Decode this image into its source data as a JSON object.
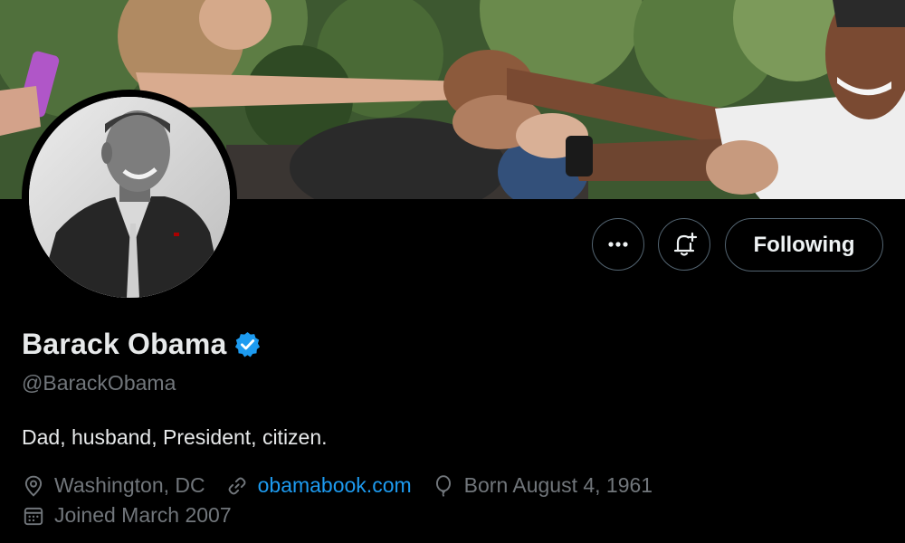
{
  "profile": {
    "name": "Barack Obama",
    "handle": "@BarackObama",
    "bio": "Dad, husband, President, citizen.",
    "verified": true
  },
  "actions": {
    "follow_label": "Following"
  },
  "meta": {
    "location": "Washington, DC",
    "website": "obamabook.com",
    "birthday": "Born August 4, 1961",
    "joined": "Joined March 2007"
  },
  "icons": {
    "more": "more-horizontal-icon",
    "notify": "bell-plus-icon",
    "verified": "verified-badge-icon",
    "location": "location-pin-icon",
    "link": "link-icon",
    "birthday": "balloon-icon",
    "joined": "calendar-icon"
  },
  "colors": {
    "background": "#000000",
    "accent": "#1d9bf0",
    "muted": "#71767b",
    "text": "#e7e9ea"
  }
}
